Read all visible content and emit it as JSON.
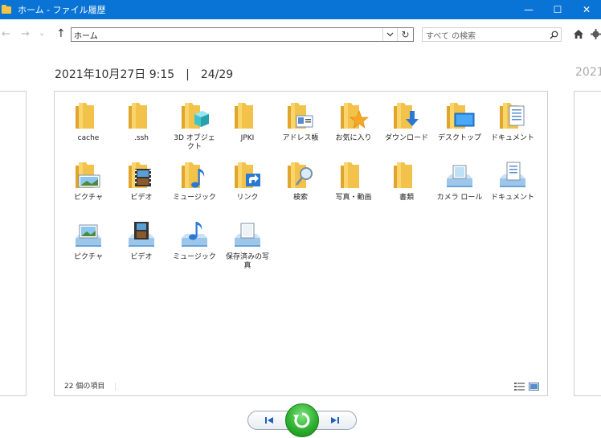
{
  "window": {
    "title": "ホーム - ファイル履歴",
    "minimize_glyph": "—",
    "maximize_glyph": "☐",
    "close_glyph": "✕"
  },
  "nav": {
    "back_glyph": "←",
    "forward_glyph": "→",
    "recent_glyph": "⌄",
    "up_glyph": "↑",
    "address": "ホーム",
    "refresh_glyph": "↻",
    "search_placeholder": "すべて の検索"
  },
  "snapshot": {
    "current_label": "2021年10月27日 9:15　|　24/29",
    "next_label_partial": "2021"
  },
  "items": [
    {
      "label": "cache",
      "icon": "folder-icon"
    },
    {
      "label": ".ssh",
      "icon": "folder-icon"
    },
    {
      "label": "3D オブジェクト",
      "icon": "3d-objects-folder-icon"
    },
    {
      "label": "JPKI",
      "icon": "folder-icon"
    },
    {
      "label": "アドレス帳",
      "icon": "contacts-folder-icon"
    },
    {
      "label": "お気に入り",
      "icon": "favorites-folder-icon"
    },
    {
      "label": "ダウンロード",
      "icon": "downloads-folder-icon"
    },
    {
      "label": "デスクトップ",
      "icon": "desktop-folder-icon"
    },
    {
      "label": "ドキュメント",
      "icon": "documents-folder-icon"
    },
    {
      "label": "ピクチャ",
      "icon": "pictures-folder-icon"
    },
    {
      "label": "ビデオ",
      "icon": "videos-folder-icon"
    },
    {
      "label": "ミュージック",
      "icon": "music-folder-icon"
    },
    {
      "label": "リンク",
      "icon": "links-folder-icon"
    },
    {
      "label": "検索",
      "icon": "searches-folder-icon"
    },
    {
      "label": "写真・動画",
      "icon": "folder-icon"
    },
    {
      "label": "書類",
      "icon": "folder-icon"
    },
    {
      "label": "カメラ ロール",
      "icon": "camera-roll-library-icon"
    },
    {
      "label": "ドキュメント",
      "icon": "documents-library-icon"
    },
    {
      "label": "ピクチャ",
      "icon": "pictures-library-icon"
    },
    {
      "label": "ビデオ",
      "icon": "videos-library-icon"
    },
    {
      "label": "ミュージック",
      "icon": "music-library-icon"
    },
    {
      "label": "保存済みの写真",
      "icon": "saved-pictures-library-icon"
    }
  ],
  "status": {
    "count_text": "22 個の項目"
  },
  "colors": {
    "titlebar": "#0a74d6",
    "folder": "#f5c542",
    "restore_green": "#2fb02f",
    "control_blue": "#1f5fbf"
  }
}
